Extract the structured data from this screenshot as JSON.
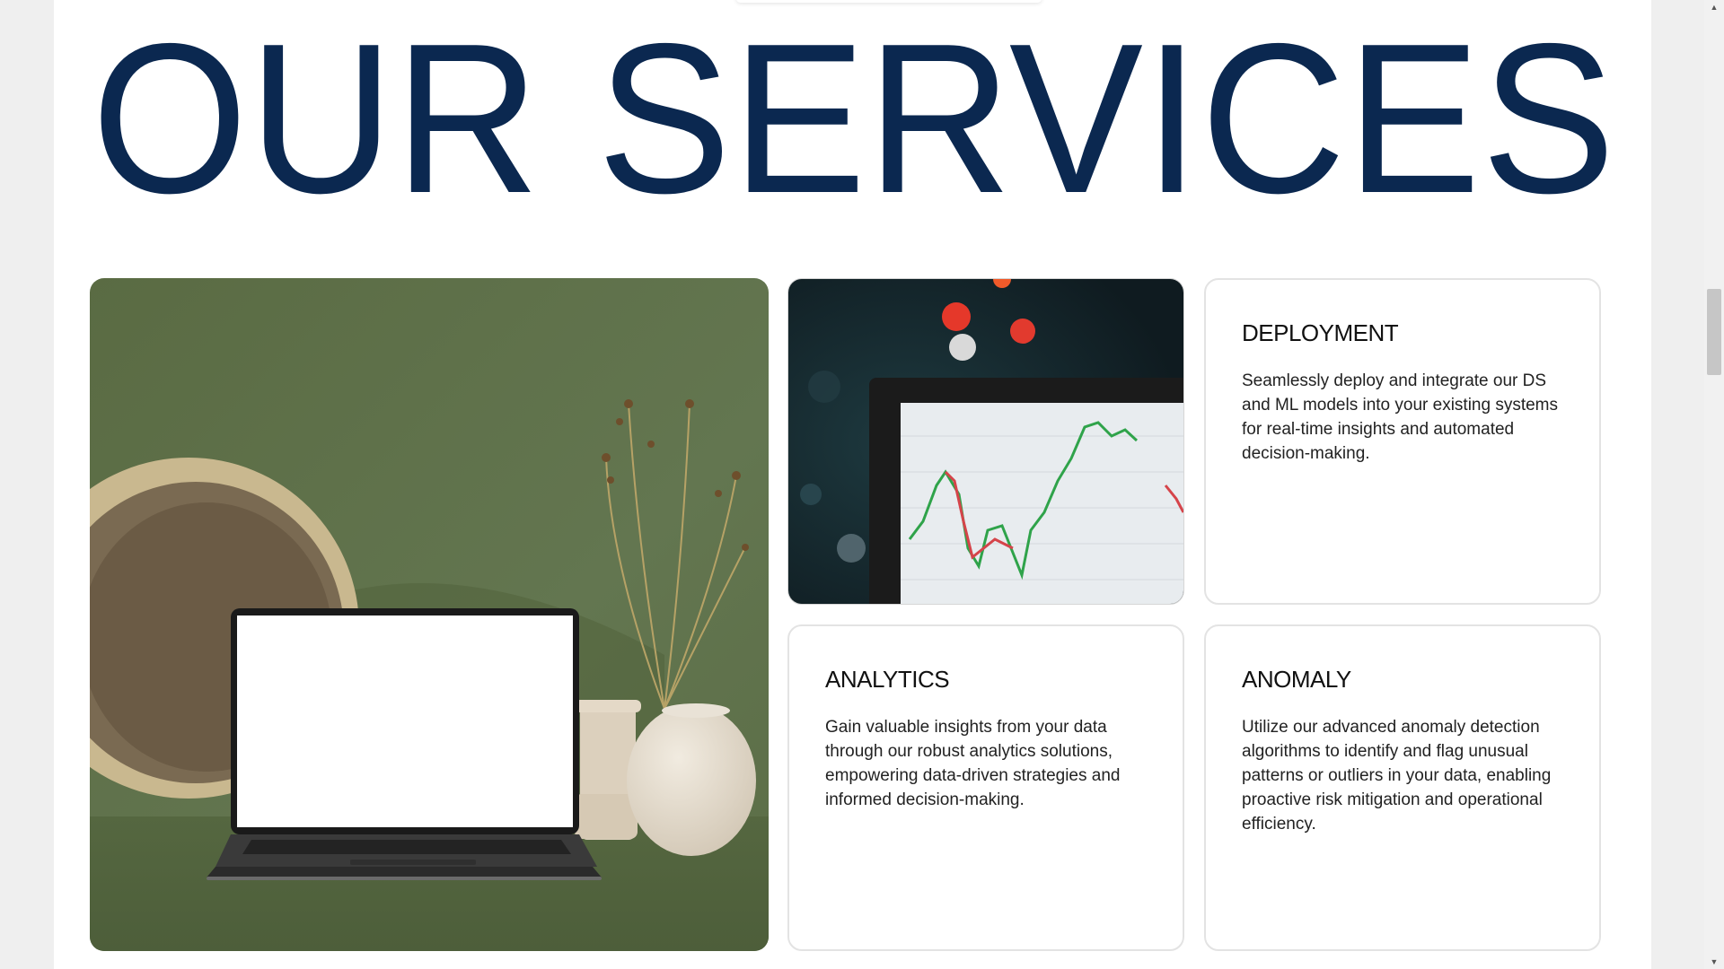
{
  "page": {
    "title": "OUR SERVICES"
  },
  "services": [
    {
      "title": "DEPLOYMENT",
      "text": "Seamlessly deploy and integrate our DS and ML models into your existing systems for real-time insights and automated decision-making."
    },
    {
      "title": "ANALYTICS",
      "text": "Gain valuable insights from your data through our robust analytics solutions, empowering data-driven strategies and informed decision-making."
    },
    {
      "title": "ANOMALY",
      "text": "Utilize our advanced anomaly detection algorithms to identify and flag unusual patterns or outliers in your data, enabling proactive risk mitigation and operational efficiency."
    }
  ],
  "icons": {
    "scroll_up": "chevron-up-icon",
    "scroll_down": "chevron-down-icon"
  },
  "colors": {
    "title": "#0b2850",
    "hero_background": "#5f7148",
    "card_border": "#e3e3e3"
  }
}
